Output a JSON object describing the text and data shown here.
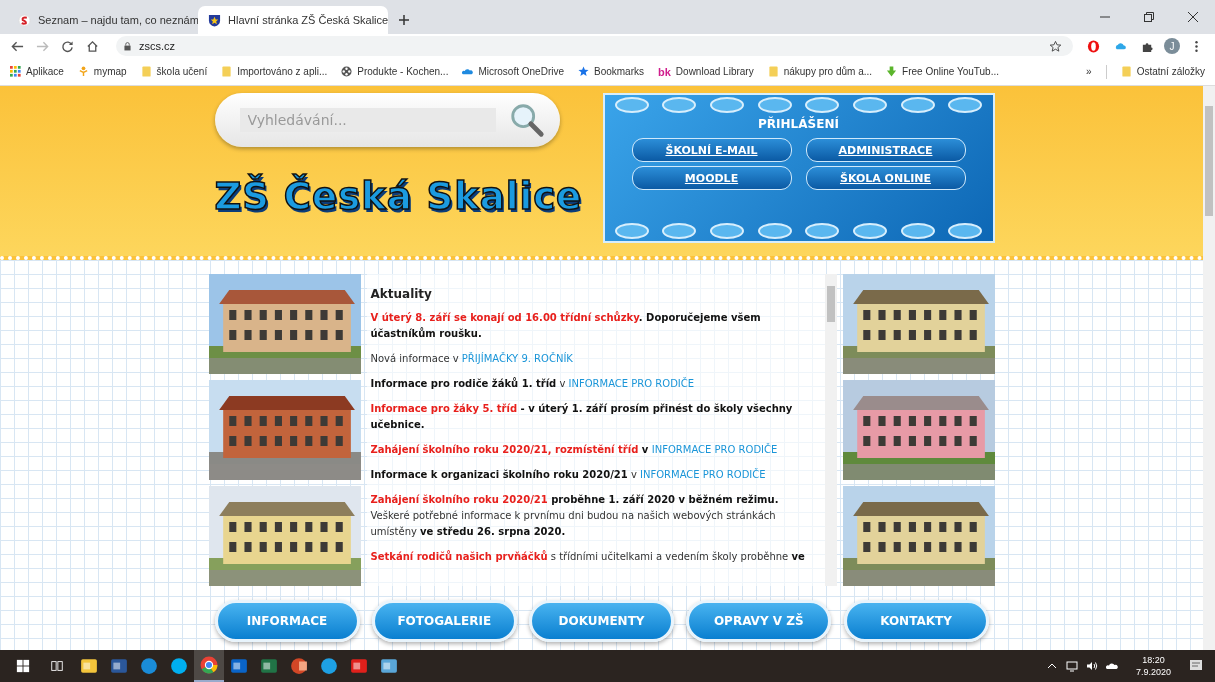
{
  "browser": {
    "tabs": [
      {
        "title": "Seznam – najdu tam, co neznám",
        "selected": false
      },
      {
        "title": "Hlavní stránka ZŠ Česká Skalice",
        "selected": true
      }
    ],
    "address": "zscs.cz",
    "bookmarks": [
      {
        "label": "Aplikace",
        "kind": "apps"
      },
      {
        "label": "mymap",
        "kind": "person"
      },
      {
        "label": "škola učení",
        "kind": "folder"
      },
      {
        "label": "Importováno z apli...",
        "kind": "folder"
      },
      {
        "label": "Produkte - Kochen...",
        "kind": "reel"
      },
      {
        "label": "Microsoft OneDrive",
        "kind": "cloud"
      },
      {
        "label": "Bookmarks",
        "kind": "star"
      },
      {
        "label": "Download Library",
        "kind": "text",
        "mark": "bk"
      },
      {
        "label": "nákupy pro dům a...",
        "kind": "folder"
      },
      {
        "label": "Free Online YouTub...",
        "kind": "download"
      }
    ],
    "more": "»",
    "other_bookmarks": "Ostatní záložky",
    "profile_initial": "J"
  },
  "header": {
    "search_placeholder": "Vyhledávání...",
    "title": "ZŠ Česká Skalice",
    "login": {
      "heading": "PŘIHLÁŠENÍ",
      "links": [
        "ŠKOLNÍ E-MAIL",
        "ADMINISTRACE",
        "MOODLE",
        "ŠKOLA ONLINE"
      ]
    }
  },
  "news": {
    "heading": "Aktuality",
    "items": [
      {
        "parts": [
          {
            "kind": "red",
            "text": "V úterý 8. září se konají od 16.00 třídní schůzky"
          },
          {
            "kind": "bold",
            "text": ". Doporučejeme všem účastníkům roušku."
          }
        ]
      },
      {
        "parts": [
          {
            "kind": "plain",
            "text": "Nová informace v "
          },
          {
            "kind": "link",
            "text": "PŘIJÍMAČKY 9. ROČNÍK"
          }
        ]
      },
      {
        "parts": [
          {
            "kind": "bold",
            "text": "Informace pro rodiče žáků 1. tříd"
          },
          {
            "kind": "plain",
            "text": " v "
          },
          {
            "kind": "link",
            "text": "INFORMACE PRO RODIČE"
          }
        ]
      },
      {
        "parts": [
          {
            "kind": "red",
            "text": "Informace pro žáky 5. tříd"
          },
          {
            "kind": "bold",
            "text": " - v úterý 1. září prosím přinést do školy všechny učebnice."
          }
        ]
      },
      {
        "parts": [
          {
            "kind": "red",
            "text": "Zahájení školního roku 2020/21, rozmístění tříd"
          },
          {
            "kind": "bold",
            "text": " v "
          },
          {
            "kind": "link",
            "text": "INFORMACE PRO RODIČE"
          }
        ]
      },
      {
        "parts": [
          {
            "kind": "bold",
            "text": "Informace k organizaci školního roku 2020/21"
          },
          {
            "kind": "plain",
            "text": " v "
          },
          {
            "kind": "link",
            "text": "INFORMACE PRO RODIČE"
          }
        ]
      },
      {
        "parts": [
          {
            "kind": "red",
            "text": "Zahájení školního roku 2020/21"
          },
          {
            "kind": "bold",
            "text": " proběhne 1. září 2020 v běžném režimu."
          },
          {
            "kind": "plain",
            "text": " Veškeré potřebné informace k prvnímu dni budou na našich webových stránkách umístěny "
          },
          {
            "kind": "bold",
            "text": "ve středu 26. srpna 2020."
          }
        ]
      },
      {
        "parts": [
          {
            "kind": "red",
            "text": "Setkání rodičů našich prvňáčků"
          },
          {
            "kind": "plain",
            "text": " s třídními učitelkami a vedením školy proběhne "
          },
          {
            "kind": "bold",
            "text": "ve"
          }
        ]
      }
    ]
  },
  "menu": [
    "INFORMACE",
    "FOTOGALERIE",
    "DOKUMENTY",
    "OPRAVY V ZŠ",
    "KONTAKTY"
  ],
  "taskbar": {
    "apps": [
      {
        "kind": "explorer",
        "selected": false
      },
      {
        "kind": "word",
        "selected": false
      },
      {
        "kind": "edge",
        "selected": false
      },
      {
        "kind": "skype",
        "selected": false
      },
      {
        "kind": "chrome",
        "selected": true
      },
      {
        "kind": "outlook",
        "selected": false
      },
      {
        "kind": "excel",
        "selected": false
      },
      {
        "kind": "powerpoint",
        "selected": false
      },
      {
        "kind": "ie",
        "selected": false
      },
      {
        "kind": "acrobat",
        "selected": false
      },
      {
        "kind": "window",
        "selected": false
      }
    ],
    "time": "18:20",
    "date": "7.9.2020"
  }
}
